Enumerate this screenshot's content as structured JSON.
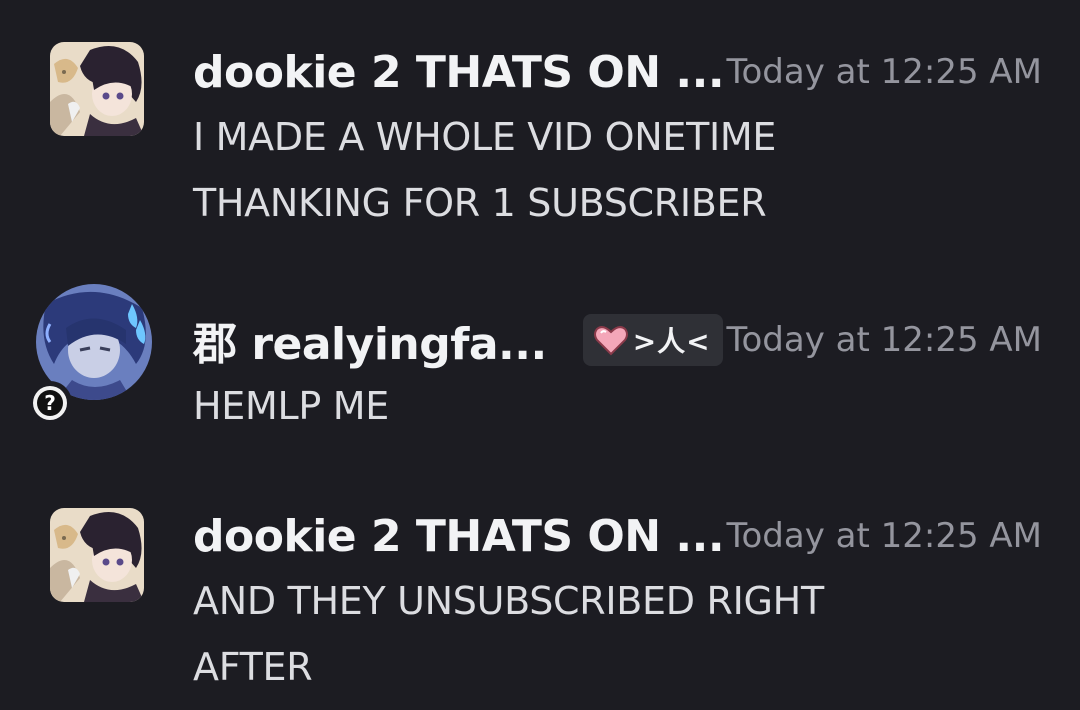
{
  "messages": [
    {
      "username": "dookie 2 THATS ON ...",
      "timestamp": "Today at 12:25 AM",
      "lines": [
        "I MADE A WHOLE VID ONETIME",
        "THANKING FOR 1 SUBSCRIBER"
      ]
    },
    {
      "username": "郡 realyingfa...",
      "role_tag": ">人<",
      "status_badge": "?",
      "timestamp": "Today at 12:25 AM",
      "lines": [
        "HEMLP ME"
      ]
    },
    {
      "username": "dookie 2 THATS ON ...",
      "timestamp": "Today at 12:25 AM",
      "lines": [
        "AND THEY UNSUBSCRIBED RIGHT",
        "AFTER"
      ]
    }
  ],
  "colors": {
    "background": "#1c1c22",
    "username": "#f2f3f5",
    "message_text": "#dcdde1",
    "timestamp": "#94959e",
    "role_tag_bg": "#2f3036",
    "heart": "#f4a7b9"
  },
  "icons": {
    "avatar_1": "anime-character-avatar",
    "avatar_2": "anime-character-avatar-blue",
    "role_tag_icon": "pink-heart-icon",
    "status_badge_icon": "question-mark-icon"
  }
}
